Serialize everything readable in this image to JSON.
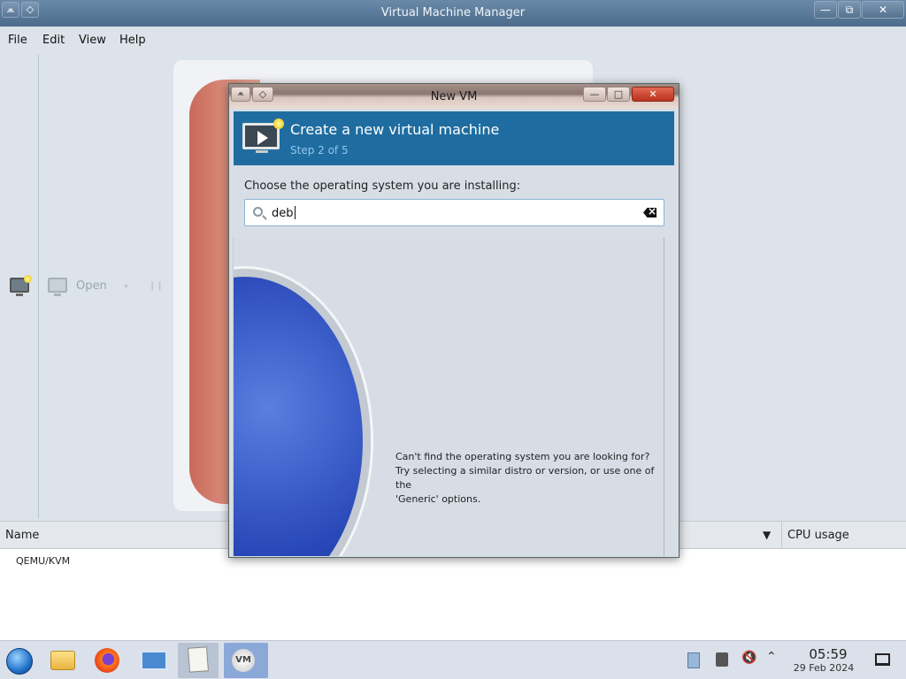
{
  "main_window": {
    "title": "Virtual Machine Manager",
    "titlebar_buttons": {
      "minimize": "—",
      "restore": "⧉",
      "close": "✕"
    },
    "menu": [
      "File",
      "Edit",
      "View",
      "Help"
    ],
    "toolbar": {
      "open_label": "Open"
    },
    "columns": {
      "name": "Name",
      "cpu_usage": "CPU usage"
    },
    "connections": [
      {
        "name": "QEMU/KVM"
      }
    ]
  },
  "dialog": {
    "title": "New VM",
    "header_title": "Create a new virtual machine",
    "step_label": "Step 2 of 5",
    "os_prompt": "Choose the operating system you are installing:",
    "search": {
      "value": "deb",
      "placeholder": ""
    },
    "not_found": {
      "line1": "Can't find the operating system you are looking for?",
      "line2": "Try selecting a similar distro or version, or use one of the",
      "line3": "'Generic' options."
    },
    "buttons": {
      "minimize": "—",
      "maximize": "□",
      "close": "✕"
    }
  },
  "taskbar": {
    "apps": [
      "start-menu",
      "file-manager",
      "firefox",
      "network-settings",
      "text-editor",
      "virt-manager"
    ],
    "vm_glyph_text": "VM",
    "clock": {
      "time": "05:59",
      "date": "29 Feb 2024"
    }
  }
}
